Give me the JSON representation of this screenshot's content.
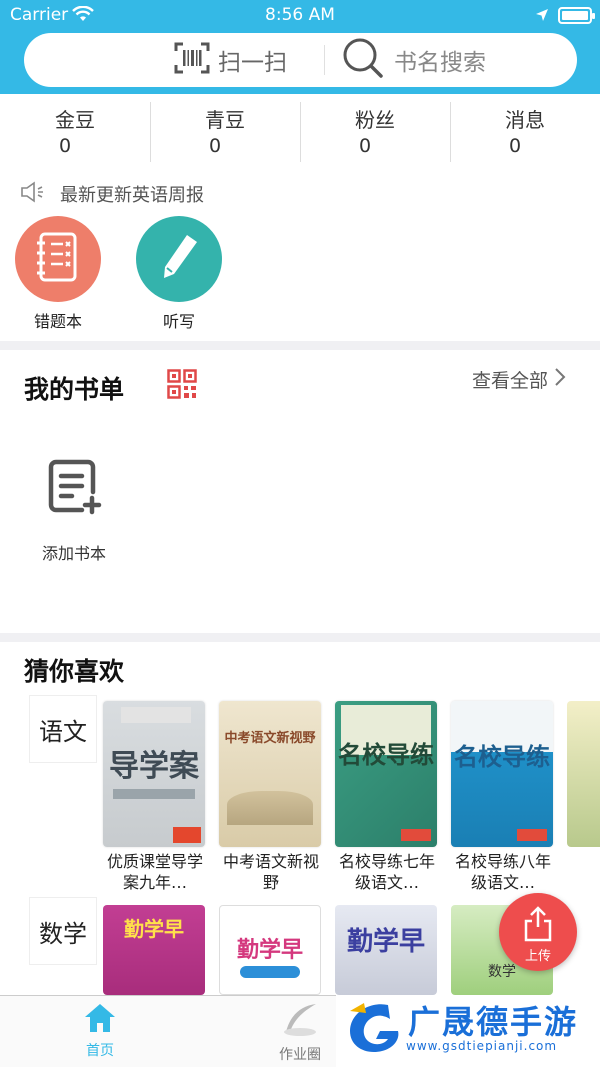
{
  "status_bar": {
    "carrier": "Carrier",
    "time": "8:56 AM"
  },
  "search_bar": {
    "scan_label": "扫一扫",
    "search_placeholder": "书名搜索"
  },
  "stats": [
    {
      "name": "金豆",
      "value": "0"
    },
    {
      "name": "青豆",
      "value": "0"
    },
    {
      "name": "粉丝",
      "value": "0"
    },
    {
      "name": "消息",
      "value": "0"
    }
  ],
  "notice": {
    "text": "最新更新英语周报"
  },
  "shortcuts": [
    {
      "label": "错题本",
      "icon": "notebook-icon",
      "color": "#ee7e6a"
    },
    {
      "label": "听写",
      "icon": "pencil-icon",
      "color": "#34b3ac"
    }
  ],
  "my_books": {
    "title": "我的书单",
    "view_all": "查看全部",
    "add_book_label": "添加书本"
  },
  "recommend": {
    "title": "猜你喜欢",
    "subjects": [
      {
        "name": "语文",
        "books": [
          {
            "title": "优质课堂导学案九年…",
            "cover_text": "导学案"
          },
          {
            "title": "中考语文新视野",
            "cover_text": "中考语文新视野"
          },
          {
            "title": "名校导练七年级语文…",
            "cover_text": "名校导练"
          },
          {
            "title": "名校导练八年级语文…",
            "cover_text": "名校导练"
          }
        ]
      },
      {
        "name": "数学",
        "books": [
          {
            "cover_text": "勤学早"
          },
          {
            "cover_text": "勤学早"
          },
          {
            "cover_text": "勤学早"
          },
          {
            "cover_text": "数学"
          }
        ]
      }
    ]
  },
  "tabs": [
    {
      "label": "首页",
      "icon": "home-icon",
      "active": true
    },
    {
      "label": "作业圈",
      "icon": "feather-icon",
      "active": false
    }
  ],
  "upload_button": {
    "label": "上传"
  },
  "watermark": {
    "brand": "广晟德手游",
    "url": "www.gsdtiepianji.com"
  },
  "colors": {
    "header": "#34b9e6",
    "accent_red": "#ee4d4d",
    "tab_active": "#34b9e6"
  }
}
